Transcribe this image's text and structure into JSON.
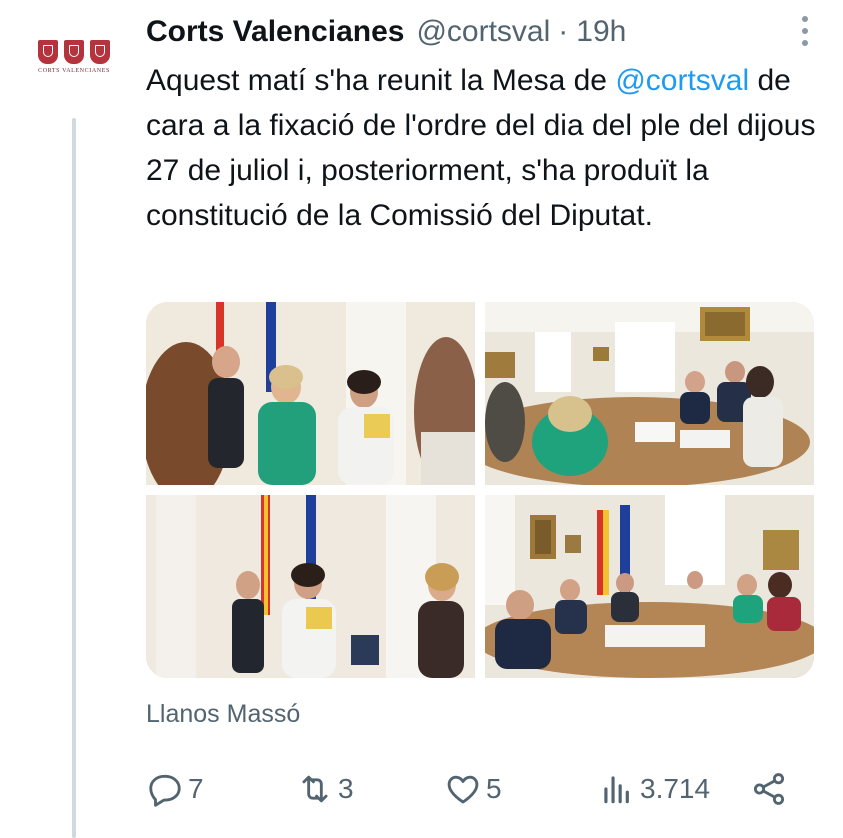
{
  "tweet": {
    "author_name": "Corts Valencianes",
    "handle": "@cortsval",
    "separator": "·",
    "time": "19h",
    "text_before": "Aquest matí s'ha reunit la Mesa de ",
    "mention": "@cortsval",
    "text_after": " de cara a la fixació de l'ordre del dia del ple del dijous 27 de juliol i, posteriorment, s'ha produït la constitució de la Comissió del Diputat.",
    "photo_credit": "Llanos Massó",
    "avatar_brand": "CORTS VALENCIANES"
  },
  "actions": {
    "replies": "7",
    "retweets": "3",
    "likes": "5",
    "views": "3.714"
  },
  "icons": {
    "reply": "comment-icon",
    "retweet": "retweet-icon",
    "like": "heart-icon",
    "views": "analytics-icon",
    "share": "share-icon",
    "more": "more-vertical-icon"
  },
  "colors": {
    "mention": "#1d9bf0",
    "secondary": "#536471",
    "thread_line": "#cfd9de"
  }
}
